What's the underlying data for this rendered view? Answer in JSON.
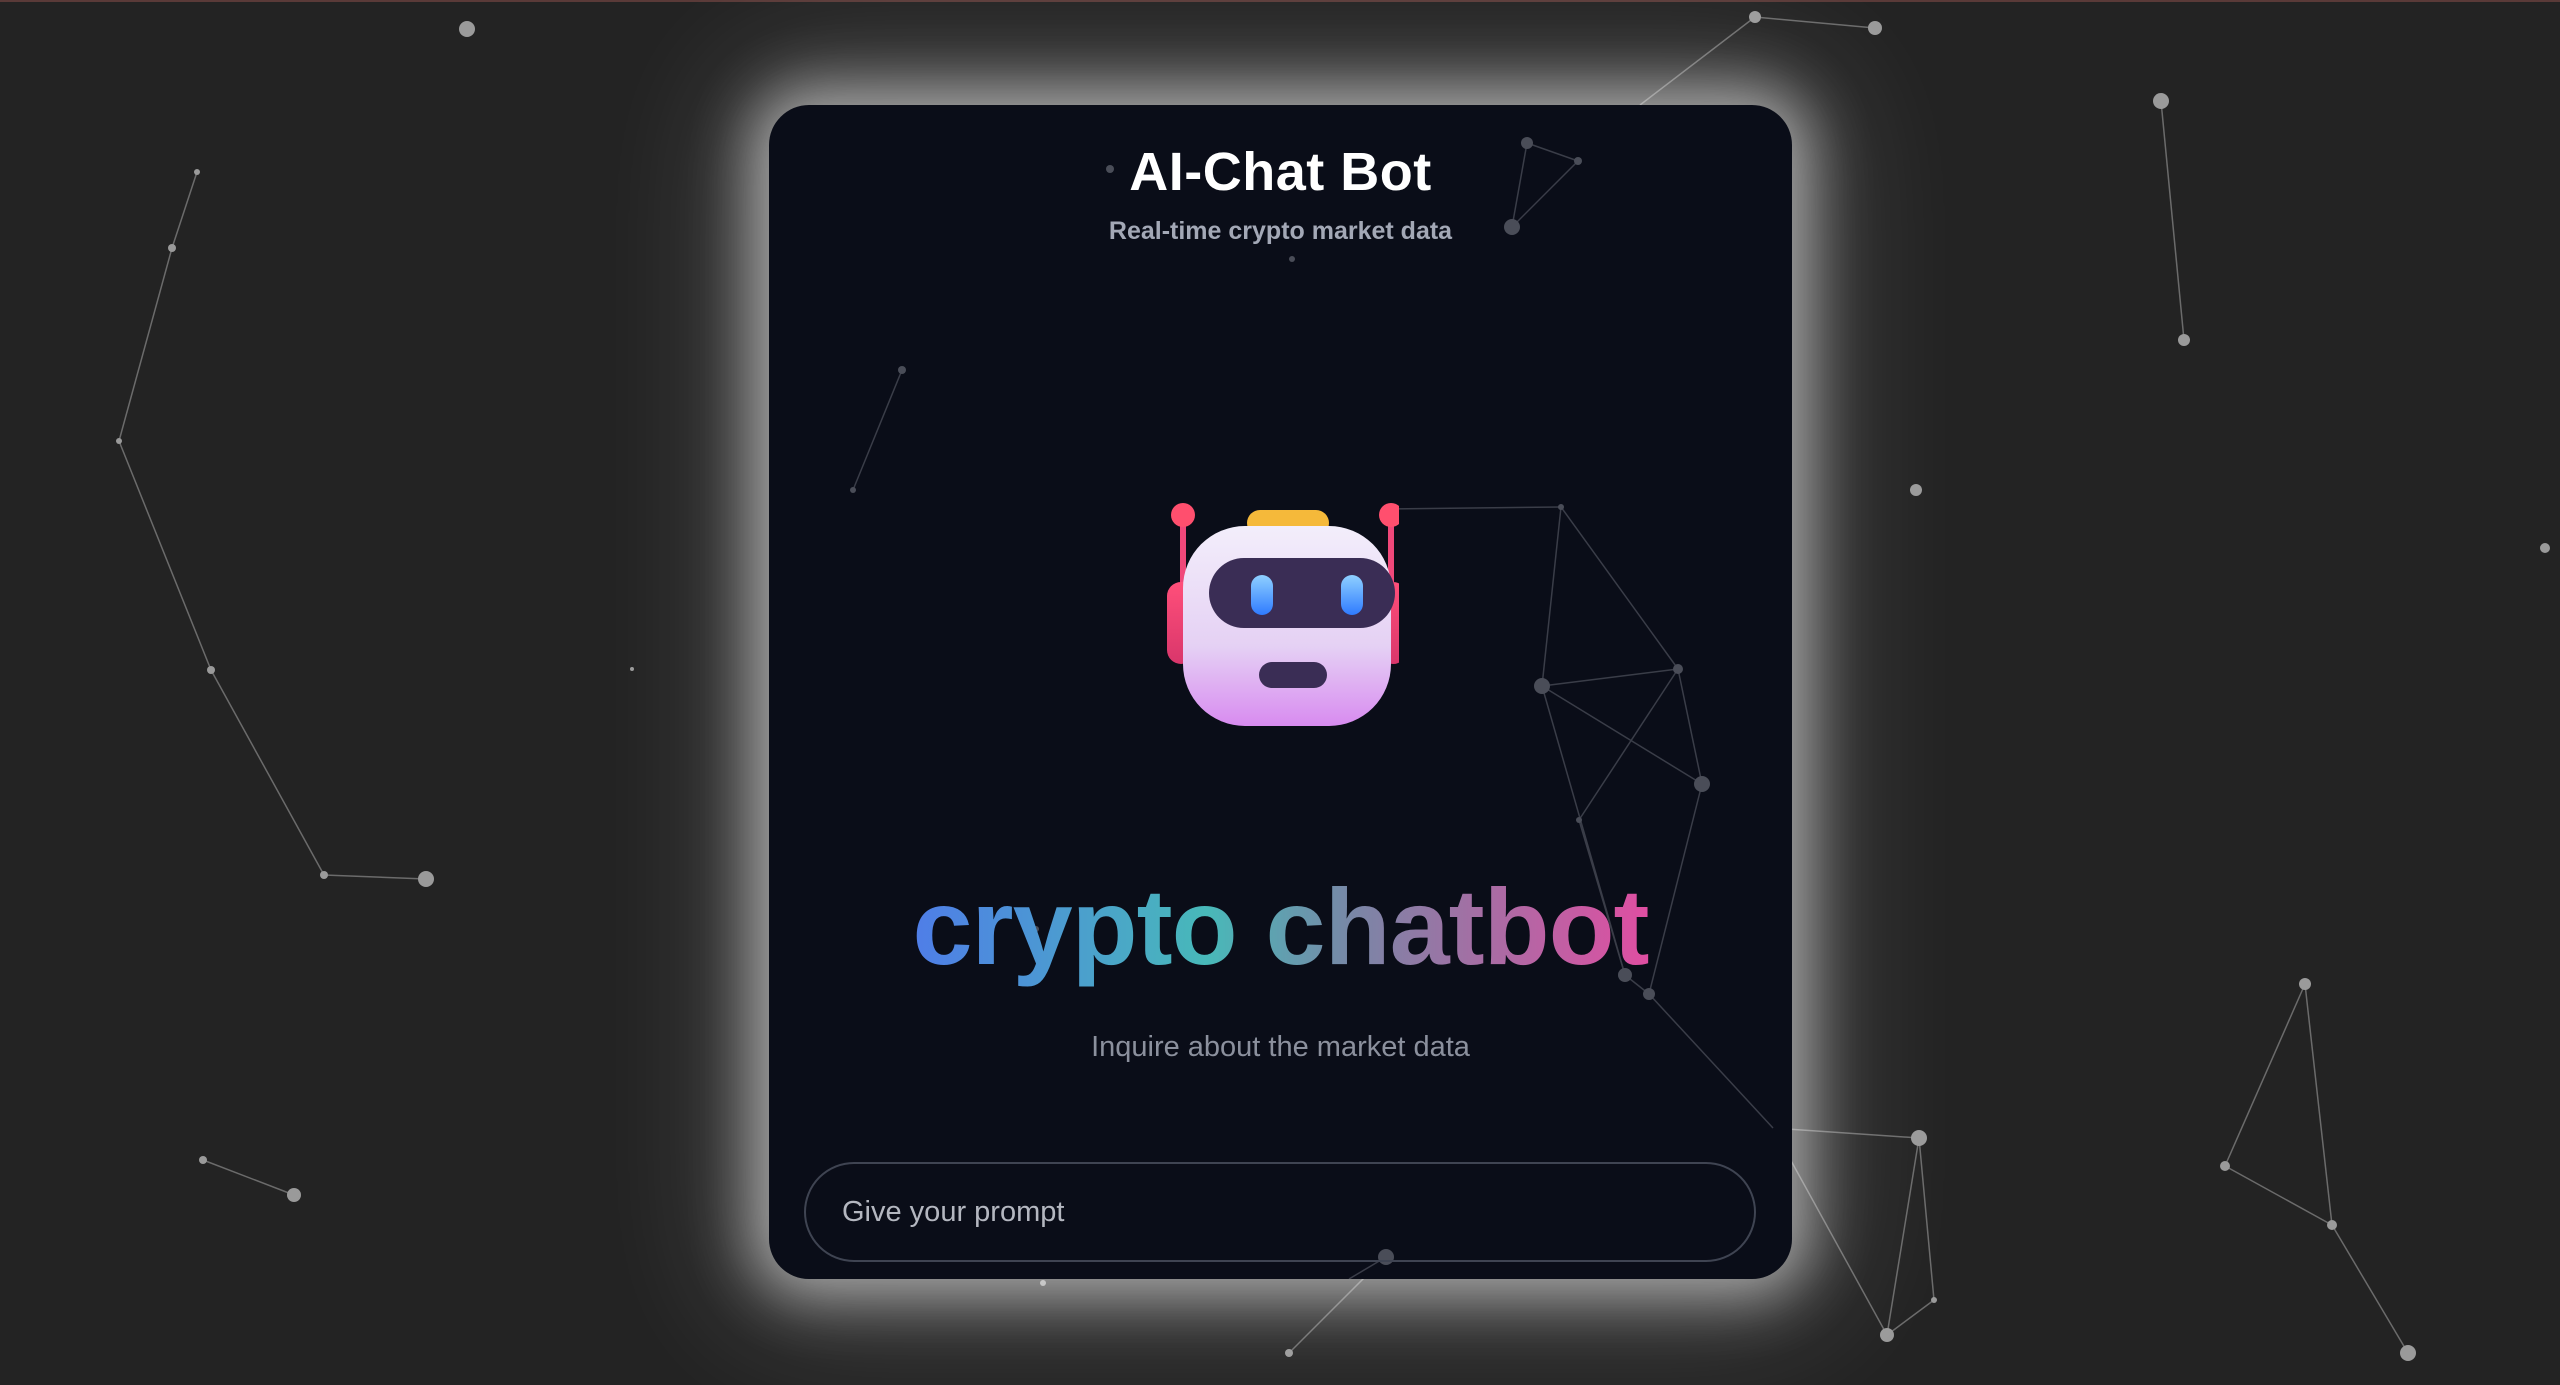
{
  "header": {
    "title": "AI-Chat Bot",
    "subtitle": "Real-time crypto market data"
  },
  "hero": {
    "icon": "robot-icon",
    "headline": "crypto chatbot",
    "hint": "Inquire about the market data"
  },
  "prompt": {
    "placeholder": "Give your prompt",
    "value": ""
  },
  "colors": {
    "background": "#232323",
    "card": "#0a0d18",
    "gradient_start": "#4f7de8",
    "gradient_mid": "#48b9b9",
    "gradient_end": "#e04ea2"
  }
}
